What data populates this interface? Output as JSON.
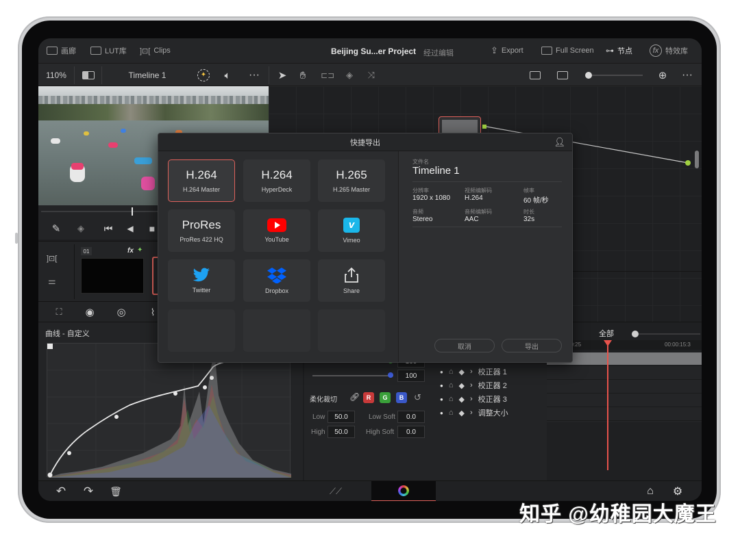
{
  "topbar": {
    "gallery": "画廊",
    "lut": "LUT库",
    "clips": "Clips",
    "project": "Beijing Su...er Project",
    "project_status": "经过编辑",
    "export": "Export",
    "fullscreen": "Full Screen",
    "nodes": "节点",
    "effects": "特效库"
  },
  "toolbar": {
    "zoom": "110%",
    "timeline": "Timeline 1"
  },
  "clip": {
    "number": "01",
    "fx": "fx"
  },
  "curves": {
    "title": "曲线 - 自定义",
    "values": [
      "100",
      "100",
      "100",
      "100"
    ],
    "soft_clip_label": "柔化裁切",
    "channel_chips": [
      "R",
      "G",
      "B"
    ],
    "low_label": "Low",
    "low_value": "50.0",
    "high_label": "High",
    "high_value": "50.0",
    "low_soft_label": "Low Soft",
    "low_soft_value": "0.0",
    "high_soft_label": "High Soft",
    "high_soft_value": "0.0"
  },
  "layers": {
    "items": [
      "校正器 1",
      "校正器 2",
      "校正器 3",
      "调整大小"
    ]
  },
  "timeline_panel": {
    "all": "全部",
    "tc_left": "00:25",
    "tc_right": "00:00:15:3"
  },
  "dialog": {
    "title": "快捷导出",
    "presets": [
      {
        "big": "H.264",
        "sub": "H.264 Master",
        "selected": true
      },
      {
        "big": "H.264",
        "sub": "HyperDeck"
      },
      {
        "big": "H.265",
        "sub": "H.265 Master"
      },
      {
        "big": "ProRes",
        "sub": "ProRes 422 HQ"
      },
      {
        "icon": "youtube-icon",
        "sub": "YouTube"
      },
      {
        "icon": "vimeo-icon",
        "sub": "Vimeo"
      },
      {
        "icon": "twitter-icon",
        "sub": "Twitter"
      },
      {
        "icon": "dropbox-icon",
        "sub": "Dropbox"
      },
      {
        "icon": "share-icon",
        "sub": "Share"
      }
    ],
    "filename_label": "文件名",
    "filename": "Timeline 1",
    "resolution_label": "分辨率",
    "resolution": "1920 x 1080",
    "codec_label": "视频编解码",
    "codec": "H.264",
    "fps_label": "帧率",
    "fps": "60 帧/秒",
    "audio_label": "音频",
    "audio": "Stereo",
    "audio_codec_label": "音频编解码",
    "audio_codec": "AAC",
    "duration_label": "时长",
    "duration": "32s",
    "cancel": "取消",
    "export": "导出"
  },
  "watermark": "知乎 @幼稚园大魔王",
  "colors": {
    "accent_red": "#e0625c",
    "playhead": "#e8534c",
    "youtube": "#ff0000",
    "vimeo": "#1ab7ea",
    "twitter": "#1da1f2",
    "dropbox": "#0061fe"
  }
}
